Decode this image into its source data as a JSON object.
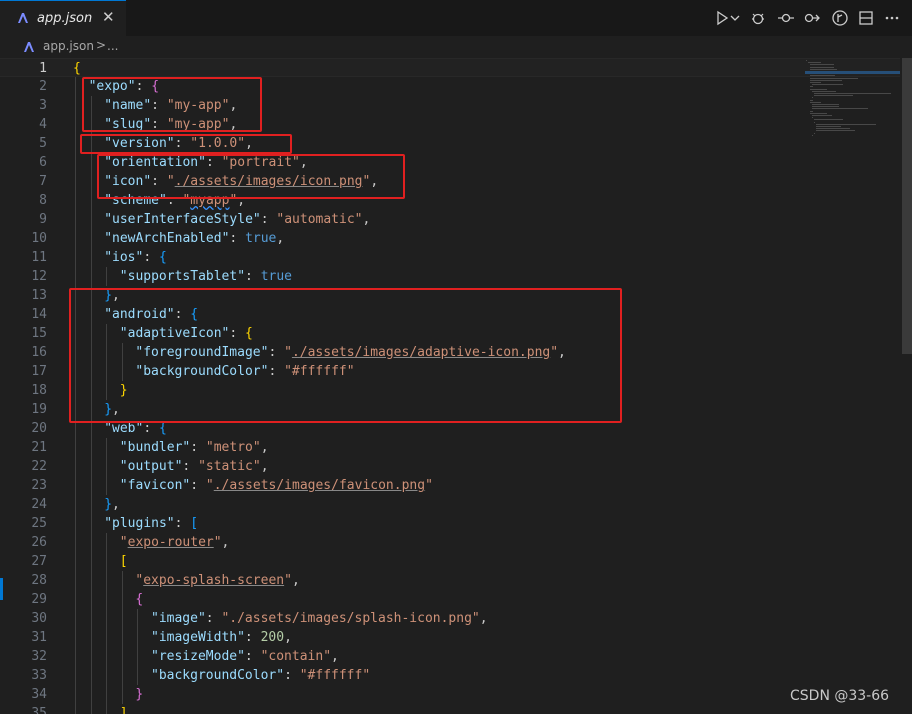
{
  "tab": {
    "title": "app.json",
    "close": "✕",
    "icon": "json-file-icon"
  },
  "breadcrumb": {
    "file": "app.json",
    "separator": ">",
    "more": "..."
  },
  "toolbar": [
    "run-icon",
    "chevron-down-icon",
    "debug-icon",
    "git-commit-icon",
    "git-compare-icon",
    "git-graph-icon",
    "split-editor-icon",
    "more-icon"
  ],
  "colors": {
    "key": "#9cdcfe",
    "string": "#ce9178",
    "bracket1": "#ffd700",
    "bracket2": "#da70d6",
    "bracket3": "#179fff",
    "boolean": "#569cd6",
    "number": "#b5cea8",
    "highlight": "#e02020"
  },
  "lines": [
    {
      "n": "1",
      "indent": 0,
      "tokens": [
        [
          "b1",
          "{"
        ]
      ]
    },
    {
      "n": "2",
      "indent": 1,
      "tokens": [
        [
          "k",
          "\"expo\""
        ],
        [
          "p",
          ": "
        ],
        [
          "b2",
          "{"
        ]
      ]
    },
    {
      "n": "3",
      "indent": 2,
      "tokens": [
        [
          "k",
          "\"name\""
        ],
        [
          "p",
          ": "
        ],
        [
          "s",
          "\"my-app\""
        ],
        [
          "p",
          ","
        ]
      ]
    },
    {
      "n": "4",
      "indent": 2,
      "tokens": [
        [
          "k",
          "\"slug\""
        ],
        [
          "p",
          ": "
        ],
        [
          "s",
          "\"my-app\""
        ],
        [
          "p",
          ","
        ]
      ]
    },
    {
      "n": "5",
      "indent": 2,
      "tokens": [
        [
          "k",
          "\"version\""
        ],
        [
          "p",
          ": "
        ],
        [
          "s",
          "\"1.0.0\""
        ],
        [
          "p",
          ","
        ]
      ]
    },
    {
      "n": "6",
      "indent": 2,
      "tokens": [
        [
          "k",
          "\"orientation\""
        ],
        [
          "p",
          ": "
        ],
        [
          "s",
          "\"portrait\""
        ],
        [
          "p",
          ","
        ]
      ]
    },
    {
      "n": "7",
      "indent": 2,
      "tokens": [
        [
          "k",
          "\"icon\""
        ],
        [
          "p",
          ": "
        ],
        [
          "s",
          "\""
        ],
        [
          "s ul",
          "./assets/images/icon.png"
        ],
        [
          "s",
          "\""
        ],
        [
          "p",
          ","
        ]
      ]
    },
    {
      "n": "8",
      "indent": 2,
      "tokens": [
        [
          "k",
          "\"scheme\""
        ],
        [
          "p",
          ": "
        ],
        [
          "s",
          "\""
        ],
        [
          "s squig",
          "myapp"
        ],
        [
          "s",
          "\""
        ],
        [
          "p",
          ","
        ]
      ]
    },
    {
      "n": "9",
      "indent": 2,
      "tokens": [
        [
          "k",
          "\"userInterfaceStyle\""
        ],
        [
          "p",
          ": "
        ],
        [
          "s",
          "\"automatic\""
        ],
        [
          "p",
          ","
        ]
      ]
    },
    {
      "n": "10",
      "indent": 2,
      "tokens": [
        [
          "k",
          "\"newArchEnabled\""
        ],
        [
          "p",
          ": "
        ],
        [
          "kw",
          "true"
        ],
        [
          "p",
          ","
        ]
      ]
    },
    {
      "n": "11",
      "indent": 2,
      "tokens": [
        [
          "k",
          "\"ios\""
        ],
        [
          "p",
          ": "
        ],
        [
          "b3",
          "{"
        ]
      ]
    },
    {
      "n": "12",
      "indent": 3,
      "tokens": [
        [
          "k",
          "\"supportsTablet\""
        ],
        [
          "p",
          ": "
        ],
        [
          "kw",
          "true"
        ]
      ]
    },
    {
      "n": "13",
      "indent": 2,
      "tokens": [
        [
          "b3",
          "}"
        ],
        [
          "p",
          ","
        ]
      ]
    },
    {
      "n": "14",
      "indent": 2,
      "tokens": [
        [
          "k",
          "\"android\""
        ],
        [
          "p",
          ": "
        ],
        [
          "b3",
          "{"
        ]
      ]
    },
    {
      "n": "15",
      "indent": 3,
      "tokens": [
        [
          "k",
          "\"adaptiveIcon\""
        ],
        [
          "p",
          ": "
        ],
        [
          "b1",
          "{"
        ]
      ]
    },
    {
      "n": "16",
      "indent": 4,
      "tokens": [
        [
          "k",
          "\"foregroundImage\""
        ],
        [
          "p",
          ": "
        ],
        [
          "s",
          "\""
        ],
        [
          "s ul",
          "./assets/images/adaptive-icon.png"
        ],
        [
          "s",
          "\""
        ],
        [
          "p",
          ","
        ]
      ]
    },
    {
      "n": "17",
      "indent": 4,
      "tokens": [
        [
          "k",
          "\"backgroundColor\""
        ],
        [
          "p",
          ": "
        ],
        [
          "s",
          "\"#ffffff\""
        ]
      ]
    },
    {
      "n": "18",
      "indent": 3,
      "tokens": [
        [
          "b1",
          "}"
        ]
      ]
    },
    {
      "n": "19",
      "indent": 2,
      "tokens": [
        [
          "b3",
          "}"
        ],
        [
          "p",
          ","
        ]
      ]
    },
    {
      "n": "20",
      "indent": 2,
      "tokens": [
        [
          "k",
          "\"web\""
        ],
        [
          "p",
          ": "
        ],
        [
          "b3",
          "{"
        ]
      ]
    },
    {
      "n": "21",
      "indent": 3,
      "tokens": [
        [
          "k",
          "\"bundler\""
        ],
        [
          "p",
          ": "
        ],
        [
          "s",
          "\"metro\""
        ],
        [
          "p",
          ","
        ]
      ]
    },
    {
      "n": "22",
      "indent": 3,
      "tokens": [
        [
          "k",
          "\"output\""
        ],
        [
          "p",
          ": "
        ],
        [
          "s",
          "\"static\""
        ],
        [
          "p",
          ","
        ]
      ]
    },
    {
      "n": "23",
      "indent": 3,
      "tokens": [
        [
          "k",
          "\"favicon\""
        ],
        [
          "p",
          ": "
        ],
        [
          "s",
          "\""
        ],
        [
          "s ul",
          "./assets/images/favicon.png"
        ],
        [
          "s",
          "\""
        ]
      ]
    },
    {
      "n": "24",
      "indent": 2,
      "tokens": [
        [
          "b3",
          "}"
        ],
        [
          "p",
          ","
        ]
      ]
    },
    {
      "n": "25",
      "indent": 2,
      "tokens": [
        [
          "k",
          "\"plugins\""
        ],
        [
          "p",
          ": "
        ],
        [
          "b3",
          "["
        ]
      ]
    },
    {
      "n": "26",
      "indent": 3,
      "tokens": [
        [
          "s",
          "\""
        ],
        [
          "s ul",
          "expo-router"
        ],
        [
          "s",
          "\""
        ],
        [
          "p",
          ","
        ]
      ]
    },
    {
      "n": "27",
      "indent": 3,
      "tokens": [
        [
          "b1",
          "["
        ]
      ]
    },
    {
      "n": "28",
      "indent": 4,
      "tokens": [
        [
          "s",
          "\""
        ],
        [
          "s ul",
          "expo-splash-screen"
        ],
        [
          "s",
          "\""
        ],
        [
          "p",
          ","
        ]
      ]
    },
    {
      "n": "29",
      "indent": 4,
      "tokens": [
        [
          "b2",
          "{"
        ]
      ]
    },
    {
      "n": "30",
      "indent": 5,
      "tokens": [
        [
          "k",
          "\"image\""
        ],
        [
          "p",
          ": "
        ],
        [
          "s",
          "\"./assets/images/splash-icon.png\""
        ],
        [
          "p",
          ","
        ]
      ]
    },
    {
      "n": "31",
      "indent": 5,
      "tokens": [
        [
          "k",
          "\"imageWidth\""
        ],
        [
          "p",
          ": "
        ],
        [
          "n",
          "200"
        ],
        [
          "p",
          ","
        ]
      ]
    },
    {
      "n": "32",
      "indent": 5,
      "tokens": [
        [
          "k",
          "\"resizeMode\""
        ],
        [
          "p",
          ": "
        ],
        [
          "s",
          "\"contain\""
        ],
        [
          "p",
          ","
        ]
      ]
    },
    {
      "n": "33",
      "indent": 5,
      "tokens": [
        [
          "k",
          "\"backgroundColor\""
        ],
        [
          "p",
          ": "
        ],
        [
          "s",
          "\"#ffffff\""
        ]
      ]
    },
    {
      "n": "34",
      "indent": 4,
      "tokens": [
        [
          "b2",
          "}"
        ]
      ]
    },
    {
      "n": "35",
      "indent": 3,
      "tokens": [
        [
          "b1",
          "]"
        ]
      ]
    }
  ],
  "watermark": "CSDN @33-66"
}
